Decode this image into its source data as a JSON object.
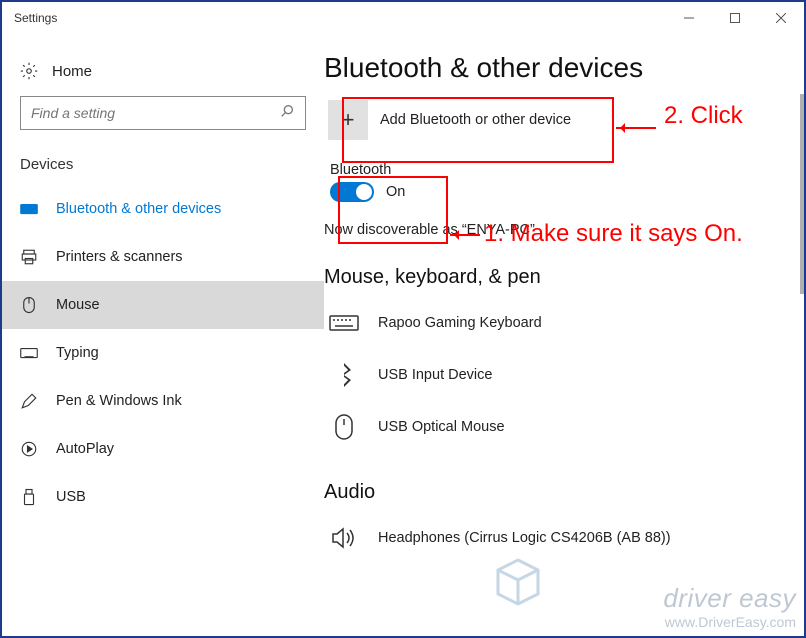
{
  "window": {
    "title": "Settings"
  },
  "home": {
    "label": "Home"
  },
  "search": {
    "placeholder": "Find a setting"
  },
  "sidebar": {
    "section": "Devices",
    "items": [
      {
        "label": "Bluetooth & other devices"
      },
      {
        "label": "Printers & scanners"
      },
      {
        "label": "Mouse"
      },
      {
        "label": "Typing"
      },
      {
        "label": "Pen & Windows Ink"
      },
      {
        "label": "AutoPlay"
      },
      {
        "label": "USB"
      }
    ]
  },
  "main": {
    "title": "Bluetooth & other devices",
    "add_label": "Add Bluetooth or other device",
    "bt_label": "Bluetooth",
    "bt_state": "On",
    "discoverable": "Now discoverable as “ENYA-PC”",
    "sub1": "Mouse, keyboard, & pen",
    "devices1": [
      {
        "name": "Rapoo Gaming Keyboard"
      },
      {
        "name": "USB Input Device"
      },
      {
        "name": "USB Optical Mouse"
      }
    ],
    "sub2": "Audio",
    "devices2": [
      {
        "name": "Headphones (Cirrus Logic CS4206B (AB 88))"
      }
    ]
  },
  "annotations": {
    "a1": "1. Make sure it says On.",
    "a2": "2. Click"
  },
  "watermark": {
    "brand": "driver easy",
    "url": "www.DriverEasy.com"
  }
}
